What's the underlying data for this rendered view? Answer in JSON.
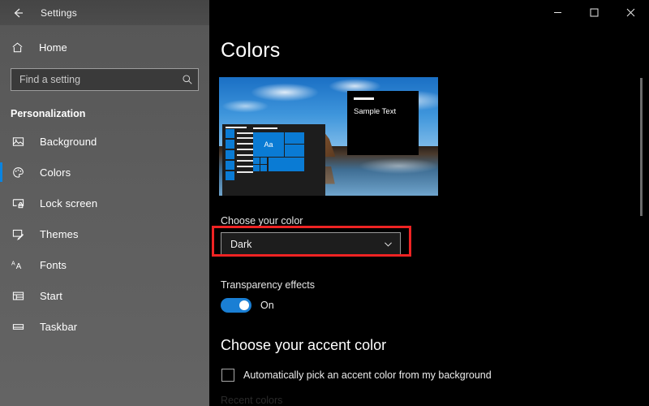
{
  "titlebar": {
    "back_icon": "back-arrow-icon",
    "app_title": "Settings",
    "minimize_label": "minimize-icon",
    "maximize_label": "maximize-icon",
    "close_label": "close-icon"
  },
  "sidebar": {
    "home_label": "Home",
    "home_icon": "home-icon",
    "search": {
      "placeholder": "Find a setting",
      "value": "",
      "icon": "search-icon"
    },
    "section_title": "Personalization",
    "accent_color": "#0a84e0",
    "items": [
      {
        "label": "Background",
        "icon": "picture-icon",
        "selected": false
      },
      {
        "label": "Colors",
        "icon": "palette-icon",
        "selected": true
      },
      {
        "label": "Lock screen",
        "icon": "lock-screen-icon",
        "selected": false
      },
      {
        "label": "Themes",
        "icon": "themes-icon",
        "selected": false
      },
      {
        "label": "Fonts",
        "icon": "fonts-icon",
        "selected": false
      },
      {
        "label": "Start",
        "icon": "start-icon",
        "selected": false
      },
      {
        "label": "Taskbar",
        "icon": "taskbar-icon",
        "selected": false
      }
    ]
  },
  "main": {
    "page_title": "Colors",
    "preview": {
      "sample_text": "Sample Text",
      "tile_text": "Aa"
    },
    "choose_color": {
      "label": "Choose your color",
      "value": "Dark",
      "chevron_icon": "chevron-down-icon",
      "highlight_color": "#ef2323"
    },
    "transparency": {
      "label": "Transparency effects",
      "state": "On",
      "toggle_on": true,
      "toggle_color": "#1a7fd4"
    },
    "accent_section": {
      "heading": "Choose your accent color",
      "auto_pick_label": "Automatically pick an accent color from my background",
      "auto_pick_checked": false,
      "recent_colors_label": "Recent colors"
    }
  }
}
